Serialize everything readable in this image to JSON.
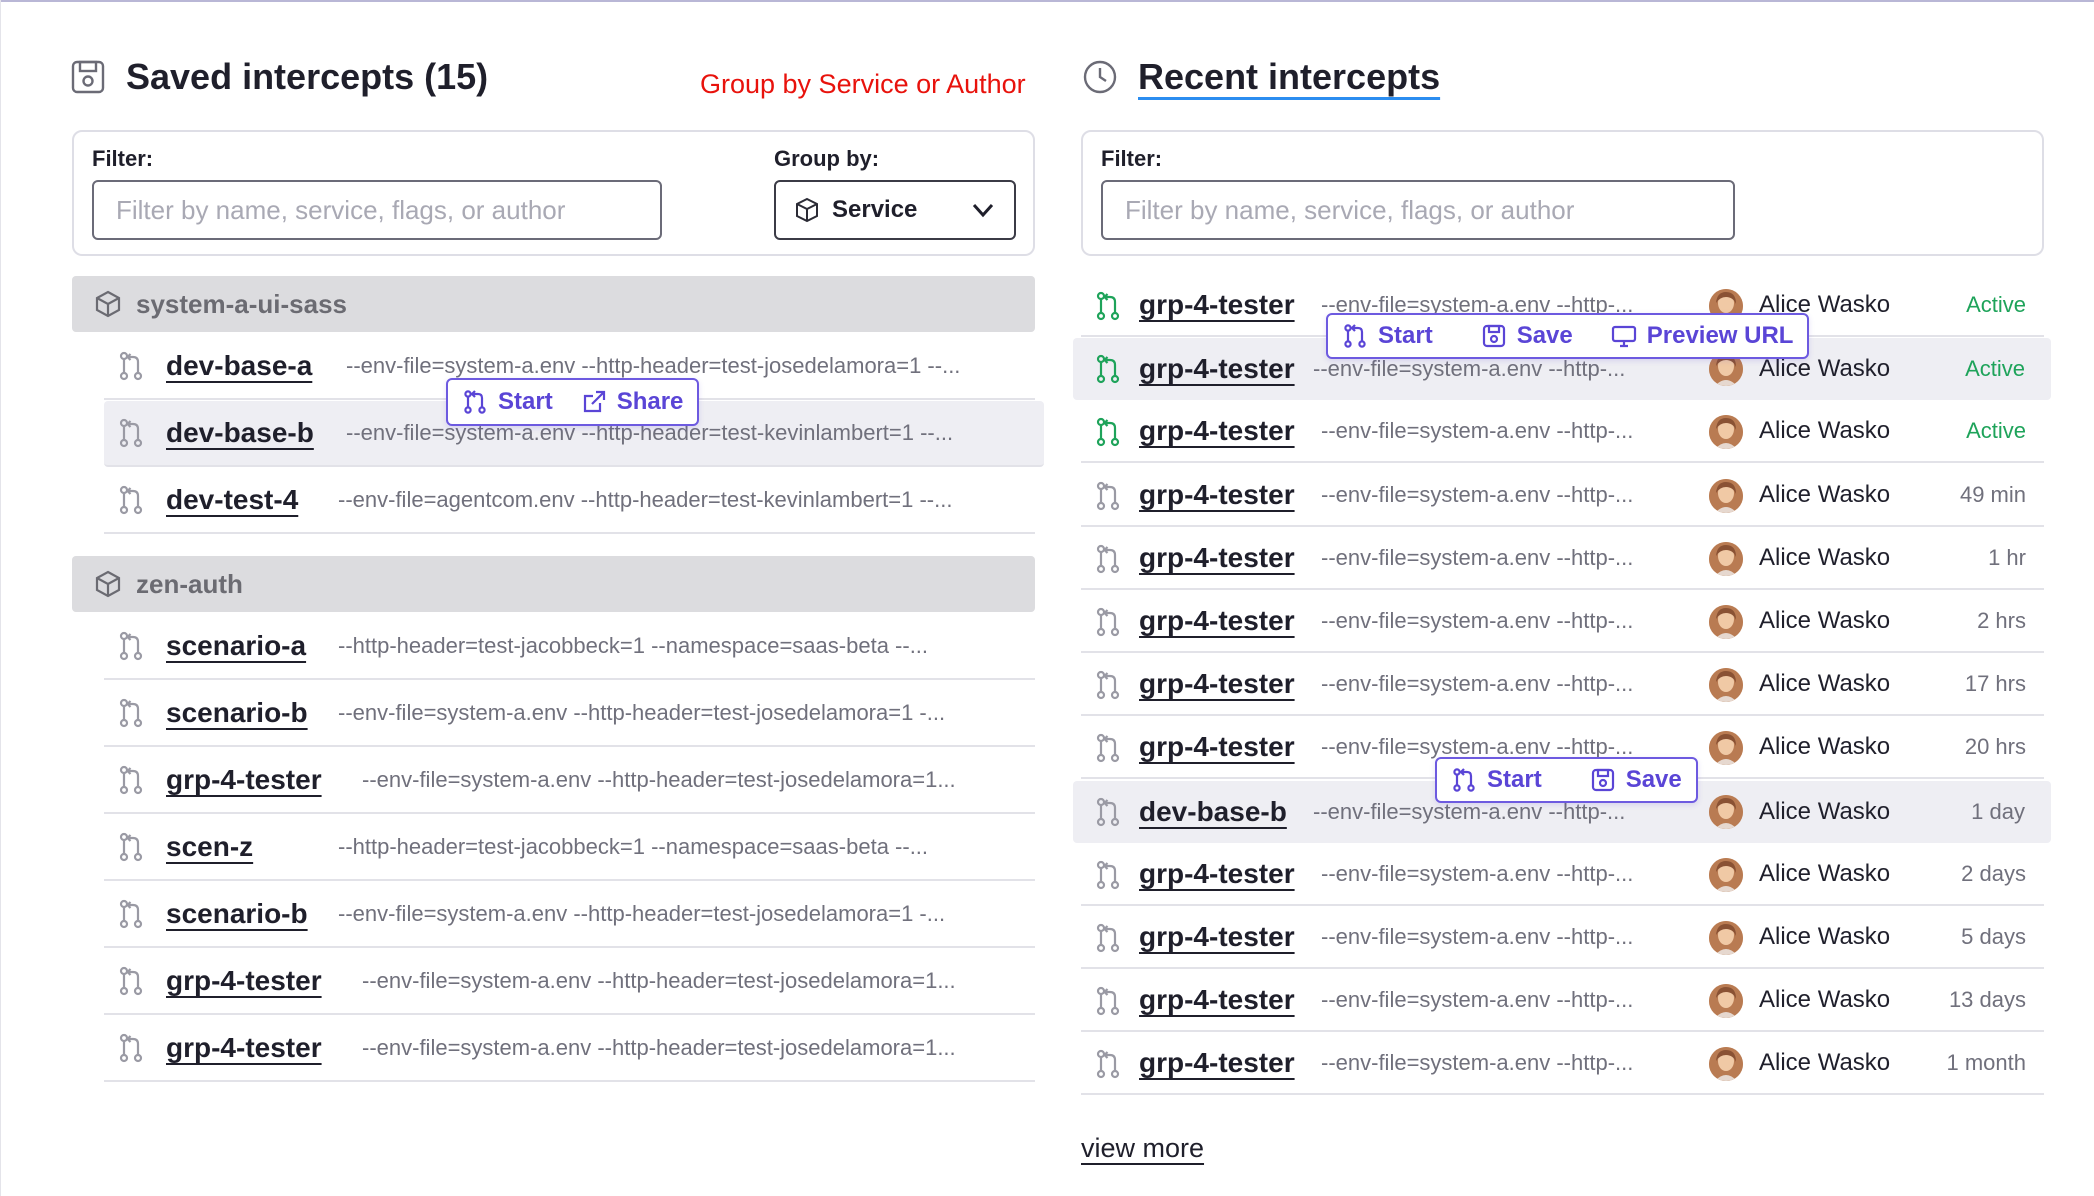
{
  "saved": {
    "title": "Saved intercepts (15)",
    "annotation": "Group by Service or Author",
    "filter_label": "Filter:",
    "filter_placeholder": "Filter by name, service, flags, or author",
    "group_by_label": "Group by:",
    "group_by_value": "Service",
    "groups": [
      {
        "name": "system-a-ui-sass",
        "rows": [
          {
            "name": "dev-base-a",
            "flags": "--env-file=system-a.env --http-header=test-josedelamora=1 --..."
          },
          {
            "name": "dev-base-b",
            "flags": "--env-file=system-a.env --http-header=test-kevinlambert=1 --..."
          },
          {
            "name": "dev-test-4",
            "flags": "--env-file=agentcom.env --http-header=test-kevinlambert=1 --..."
          }
        ]
      },
      {
        "name": "zen-auth",
        "rows": [
          {
            "name": "scenario-a",
            "flags": "--http-header=test-jacobbeck=1 --namespace=saas-beta --..."
          },
          {
            "name": "scenario-b",
            "flags": "--env-file=system-a.env --http-header=test-josedelamora=1 -..."
          },
          {
            "name": "grp-4-tester",
            "flags": "--env-file=system-a.env --http-header=test-josedelamora=1..."
          },
          {
            "name": "scen-z",
            "flags": "--http-header=test-jacobbeck=1 --namespace=saas-beta --..."
          },
          {
            "name": "scenario-b",
            "flags": "--env-file=system-a.env --http-header=test-josedelamora=1 -..."
          },
          {
            "name": "grp-4-tester",
            "flags": "--env-file=system-a.env --http-header=test-josedelamora=1..."
          },
          {
            "name": "grp-4-tester",
            "flags": "--env-file=system-a.env --http-header=test-josedelamora=1..."
          }
        ]
      }
    ],
    "actions": {
      "start": "Start",
      "share": "Share"
    }
  },
  "recent": {
    "title": "Recent intercepts",
    "filter_label": "Filter:",
    "filter_placeholder": "Filter by name, service, flags, or author",
    "rows": [
      {
        "name": "grp-4-tester",
        "flags": "--env-file=system-a.env --http-...",
        "author": "Alice Wasko",
        "status": "Active",
        "active": true
      },
      {
        "name": "grp-4-tester",
        "flags": "--env-file=system-a.env --http-...",
        "author": "Alice Wasko",
        "status": "Active",
        "active": true
      },
      {
        "name": "grp-4-tester",
        "flags": "--env-file=system-a.env --http-...",
        "author": "Alice Wasko",
        "status": "Active",
        "active": true
      },
      {
        "name": "grp-4-tester",
        "flags": "--env-file=system-a.env --http-...",
        "author": "Alice Wasko",
        "status": "49 min",
        "active": false
      },
      {
        "name": "grp-4-tester",
        "flags": "--env-file=system-a.env --http-...",
        "author": "Alice Wasko",
        "status": "1 hr",
        "active": false
      },
      {
        "name": "grp-4-tester",
        "flags": "--env-file=system-a.env --http-...",
        "author": "Alice Wasko",
        "status": "2 hrs",
        "active": false
      },
      {
        "name": "grp-4-tester",
        "flags": "--env-file=system-a.env --http-...",
        "author": "Alice Wasko",
        "status": "17 hrs",
        "active": false
      },
      {
        "name": "grp-4-tester",
        "flags": "--env-file=system-a.env --http-...",
        "author": "Alice Wasko",
        "status": "20 hrs",
        "active": false
      },
      {
        "name": "dev-base-b",
        "flags": "--env-file=system-a.env --http-...",
        "author": "Alice Wasko",
        "status": "1 day",
        "active": false
      },
      {
        "name": "grp-4-tester",
        "flags": "--env-file=system-a.env --http-...",
        "author": "Alice Wasko",
        "status": "2 days",
        "active": false
      },
      {
        "name": "grp-4-tester",
        "flags": "--env-file=system-a.env --http-...",
        "author": "Alice Wasko",
        "status": "5 days",
        "active": false
      },
      {
        "name": "grp-4-tester",
        "flags": "--env-file=system-a.env --http-...",
        "author": "Alice Wasko",
        "status": "13 days",
        "active": false
      },
      {
        "name": "grp-4-tester",
        "flags": "--env-file=system-a.env --http-...",
        "author": "Alice Wasko",
        "status": "1 month",
        "active": false
      }
    ],
    "actions_active": {
      "start": "Start",
      "save": "Save",
      "preview": "Preview URL"
    },
    "actions_inactive": {
      "start": "Start",
      "save": "Save"
    },
    "view_more": "view more"
  },
  "colors": {
    "accent": "#5a45d6",
    "active": "#1ea35a",
    "annotation": "#e8120c",
    "underline": "#2b8df0"
  }
}
